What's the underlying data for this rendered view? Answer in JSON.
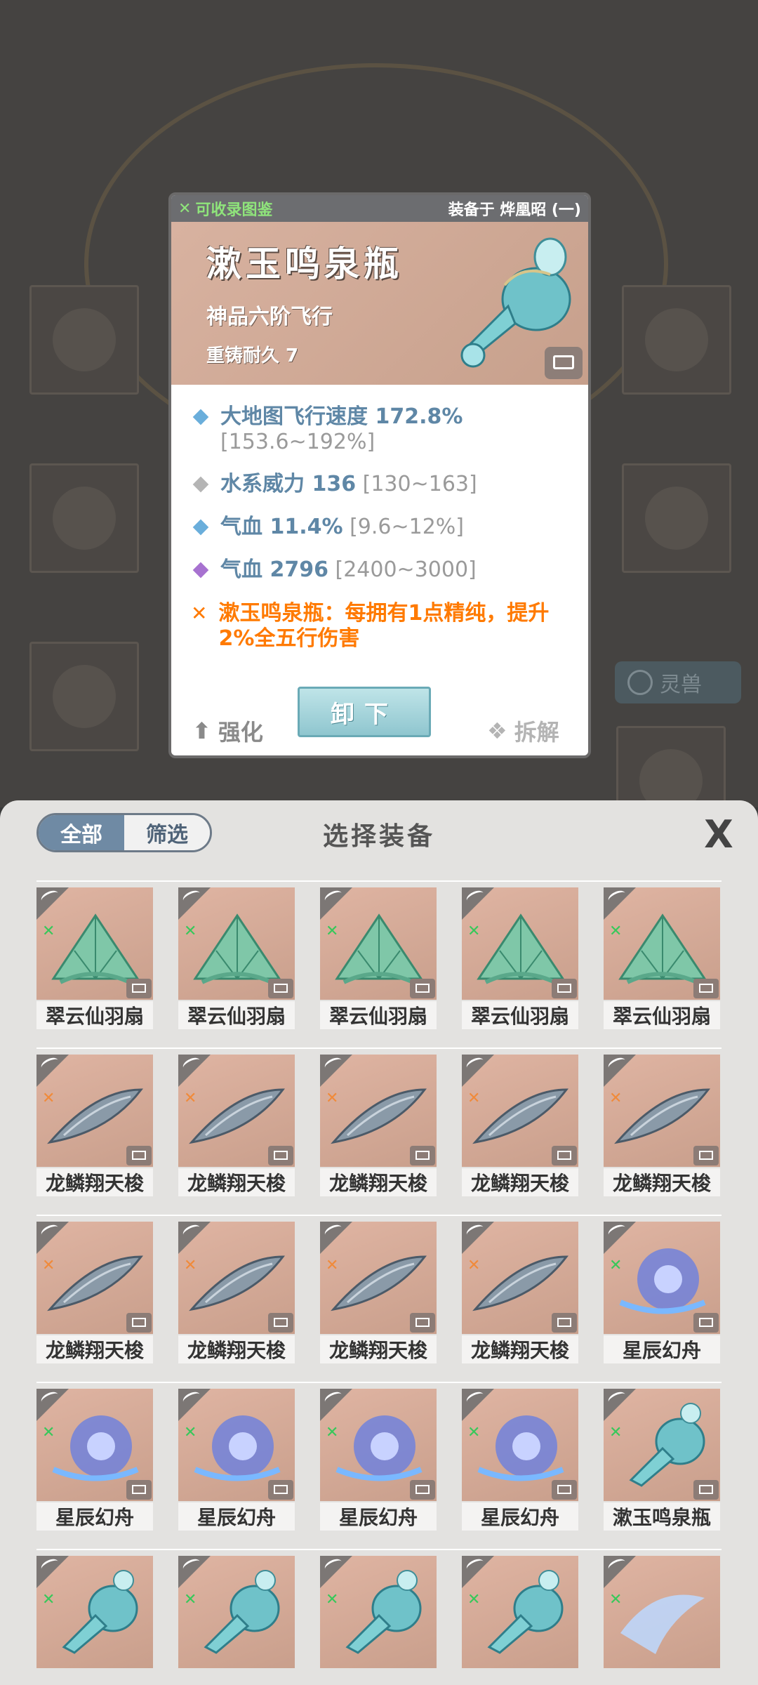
{
  "colors": {
    "attr_value": "#5f87a6",
    "attr_range": "#9a9a9a",
    "special": "#ff7a00",
    "collect": "#8fe47b",
    "diamond_blue": "#6aaedb",
    "diamond_gray": "#b5b5b5",
    "diamond_purple": "#a772d0"
  },
  "background": {
    "side_button": "灵兽"
  },
  "card": {
    "collect_label": "可收录图鉴",
    "equipped_label": "装备于 烨凰昭 (一)",
    "item_name": "漱玉鸣泉瓶",
    "item_grade": "神品六阶飞行",
    "durability": "重铸耐久 7",
    "attributes": [
      {
        "value": "大地图飞行速度 172.8%",
        "range": "[153.6~192%]",
        "color": "blue"
      },
      {
        "value": "水系威力 136",
        "range": "[130~163]",
        "color": "gray"
      },
      {
        "value": "气血 11.4%",
        "range": "[9.6~12%]",
        "color": "blue"
      },
      {
        "value": "气血 2796",
        "range": "[2400~3000]",
        "color": "purple"
      }
    ],
    "special_text": "漱玉鸣泉瓶：每拥有1点精纯，提升2%全五行伤害",
    "buttons": {
      "strengthen": "强化",
      "unequip": "卸下",
      "disassemble": "拆解"
    }
  },
  "panel": {
    "tab_all": "全部",
    "tab_filter": "筛选",
    "title": "选择装备",
    "close_label": "X",
    "items": [
      {
        "name": "翠云仙羽扇",
        "art": "fan",
        "mark": "green"
      },
      {
        "name": "翠云仙羽扇",
        "art": "fan",
        "mark": "green"
      },
      {
        "name": "翠云仙羽扇",
        "art": "fan",
        "mark": "green"
      },
      {
        "name": "翠云仙羽扇",
        "art": "fan",
        "mark": "green"
      },
      {
        "name": "翠云仙羽扇",
        "art": "fan",
        "mark": "green"
      },
      {
        "name": "龙鳞翔天梭",
        "art": "shuttle",
        "mark": "orange"
      },
      {
        "name": "龙鳞翔天梭",
        "art": "shuttle",
        "mark": "orange"
      },
      {
        "name": "龙鳞翔天梭",
        "art": "shuttle",
        "mark": "orange"
      },
      {
        "name": "龙鳞翔天梭",
        "art": "shuttle",
        "mark": "orange"
      },
      {
        "name": "龙鳞翔天梭",
        "art": "shuttle",
        "mark": "orange"
      },
      {
        "name": "龙鳞翔天梭",
        "art": "shuttle",
        "mark": "orange"
      },
      {
        "name": "龙鳞翔天梭",
        "art": "shuttle",
        "mark": "orange"
      },
      {
        "name": "龙鳞翔天梭",
        "art": "shuttle",
        "mark": "orange"
      },
      {
        "name": "龙鳞翔天梭",
        "art": "shuttle",
        "mark": "orange"
      },
      {
        "name": "星辰幻舟",
        "art": "boat",
        "mark": "green"
      },
      {
        "name": "星辰幻舟",
        "art": "boat",
        "mark": "green"
      },
      {
        "name": "星辰幻舟",
        "art": "boat",
        "mark": "green"
      },
      {
        "name": "星辰幻舟",
        "art": "boat",
        "mark": "green"
      },
      {
        "name": "星辰幻舟",
        "art": "boat",
        "mark": "green"
      },
      {
        "name": "漱玉鸣泉瓶",
        "art": "gourd",
        "mark": "green"
      },
      {
        "name": "",
        "art": "gourd",
        "mark": "green"
      },
      {
        "name": "",
        "art": "gourd",
        "mark": "green"
      },
      {
        "name": "",
        "art": "gourd",
        "mark": "green"
      },
      {
        "name": "",
        "art": "gourd",
        "mark": "green"
      },
      {
        "name": "",
        "art": "bird",
        "mark": "green"
      }
    ]
  }
}
